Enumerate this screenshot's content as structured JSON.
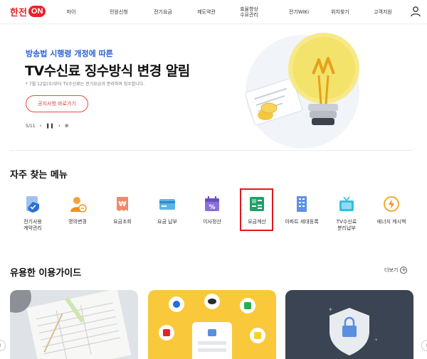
{
  "header": {
    "logo_text": "한전",
    "logo_on": "ON",
    "nav": [
      "마이",
      "민원신청",
      "전기요금",
      "제도약관",
      "효율향상\n수요관리",
      "전기WiKi",
      "위치찾기",
      "고객지원"
    ]
  },
  "hero": {
    "subtitle": "방송법 시행령 개정에 따른",
    "title": "TV수신료 징수방식 변경 알림",
    "description": "* 7월 12일(수)부터 TV수신료는 전기요금과 분리하여 징수합니다.",
    "button_label": "공지사항 바로가기",
    "pager": "5/11"
  },
  "frequent_menu": {
    "title": "자주 찾는 메뉴",
    "items": [
      {
        "label": "전기사용\n계약관리",
        "icon": "shield-check-icon"
      },
      {
        "label": "명의변경",
        "icon": "person-swap-icon"
      },
      {
        "label": "요금조회",
        "icon": "bill-search-icon"
      },
      {
        "label": "요금 납부",
        "icon": "card-pay-icon"
      },
      {
        "label": "이사정산",
        "icon": "calendar-percent-icon"
      },
      {
        "label": "요금계산",
        "icon": "calculator-icon"
      },
      {
        "label": "아파트 세대등록",
        "icon": "apartment-icon"
      },
      {
        "label": "TV수신료\n분리납부",
        "icon": "tv-icon"
      },
      {
        "label": "에너지 캐시백",
        "icon": "energy-cashback-icon"
      }
    ]
  },
  "guide": {
    "title": "유용한 이용가이드",
    "more_label": "더보기"
  },
  "colors": {
    "brand_red": "#e6232a",
    "accent_blue": "#2a62d6",
    "highlight": "#e0191e",
    "card_yellow": "#f9c93b",
    "card_dark": "#3a4452"
  }
}
